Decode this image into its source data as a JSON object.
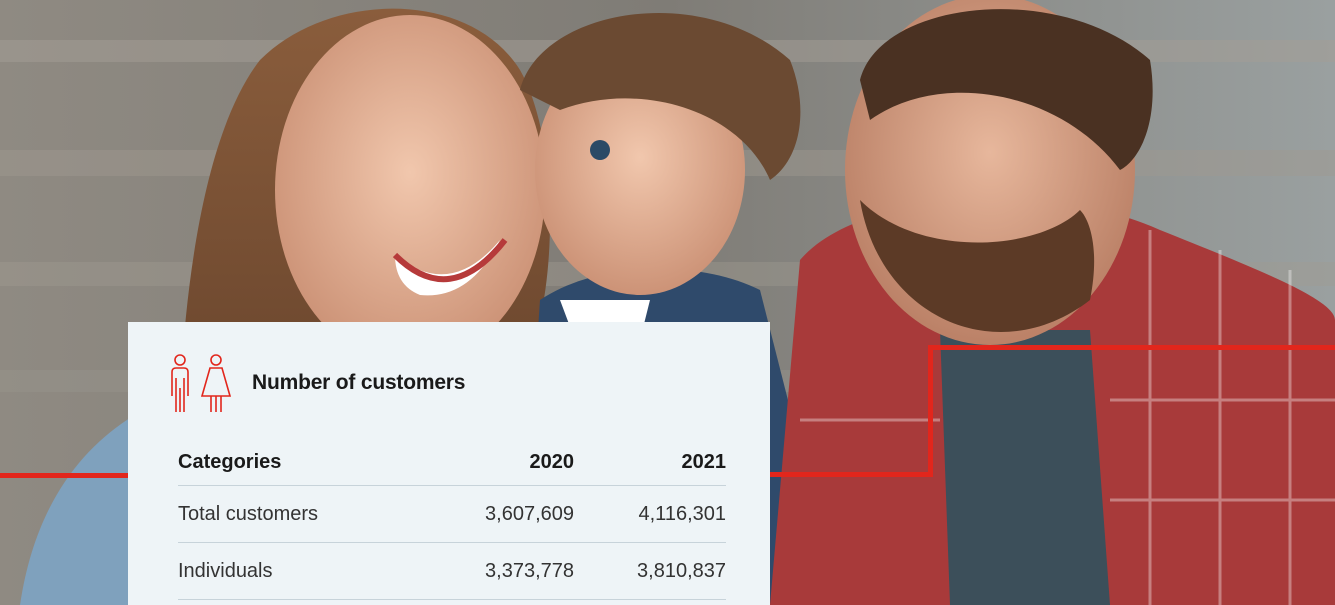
{
  "card": {
    "title": "Number of customers",
    "icon": "people-man-woman-icon",
    "accent_color": "#e2261c"
  },
  "table": {
    "headers": [
      "Categories",
      "2020",
      "2021"
    ],
    "rows": [
      {
        "category": "Total customers",
        "y2020": "3,607,609",
        "y2021": "4,116,301"
      },
      {
        "category": "Individuals",
        "y2020": "3,373,778",
        "y2021": "3,810,837"
      }
    ]
  },
  "photo": {
    "description_icon": "family-photo"
  }
}
